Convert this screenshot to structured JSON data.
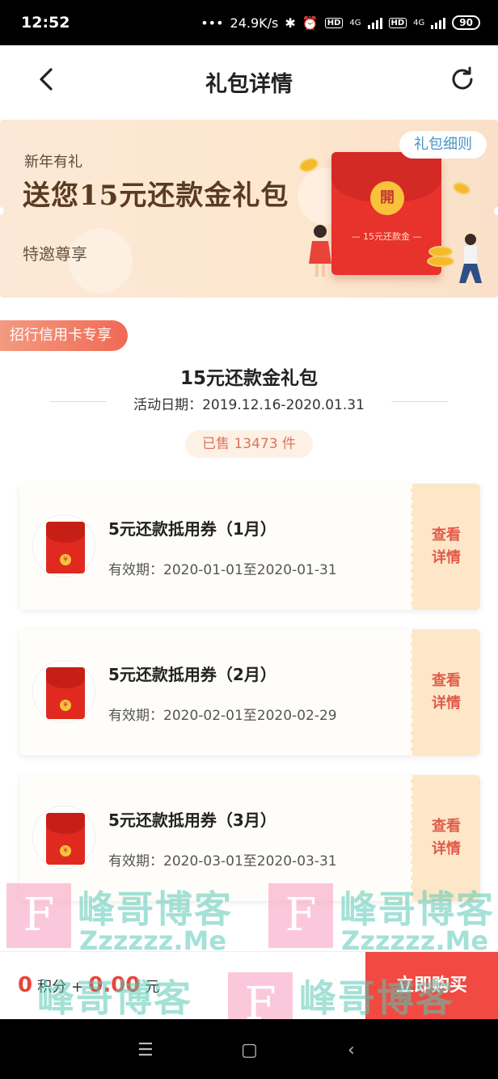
{
  "status_bar": {
    "time": "12:52",
    "net_speed": "24.9K/s",
    "hd1": "HD",
    "net1": "4G",
    "hd2": "HD",
    "net2": "4G",
    "battery": "90"
  },
  "nav": {
    "title": "礼包详情",
    "back_icon": "chevron-left-icon",
    "refresh_icon": "refresh-icon"
  },
  "banner": {
    "subtitle": "新年有礼",
    "headline": "送您15元还款金礼包",
    "invite": "特邀尊享",
    "rules_button": "礼包细则",
    "envelope_open": "開",
    "envelope_label": "— 15元还款金 —"
  },
  "package": {
    "tag": "招行信用卡专享",
    "title": "15元还款金礼包",
    "date": "活动日期：2019.12.16-2020.01.31",
    "sold": "已售 13473 件"
  },
  "coupons": [
    {
      "name": "5元还款抵用券（1月）",
      "validity": "有效期：2020-01-01至2020-01-31",
      "detail_line1": "查看",
      "detail_line2": "详情"
    },
    {
      "name": "5元还款抵用券（2月）",
      "validity": "有效期：2020-02-01至2020-02-29",
      "detail_line1": "查看",
      "detail_line2": "详情"
    },
    {
      "name": "5元还款抵用券（3月）",
      "validity": "有效期：2020-03-01至2020-03-31",
      "detail_line1": "查看",
      "detail_line2": "详情"
    }
  ],
  "bottom": {
    "points_value": "0",
    "points_label": "积分",
    "plus": "+",
    "price": "0.00",
    "currency": "元",
    "buy_button": "立即购买"
  },
  "watermark": {
    "logo_letter": "F",
    "cn_text": "峰哥博客",
    "en_text": "Zzzzzz.Me"
  },
  "colors": {
    "accent": "#f04a42",
    "tag_gradient_start": "#f39a80",
    "banner_bg": "#fde7cf",
    "detail_side": "#fde7c8"
  }
}
